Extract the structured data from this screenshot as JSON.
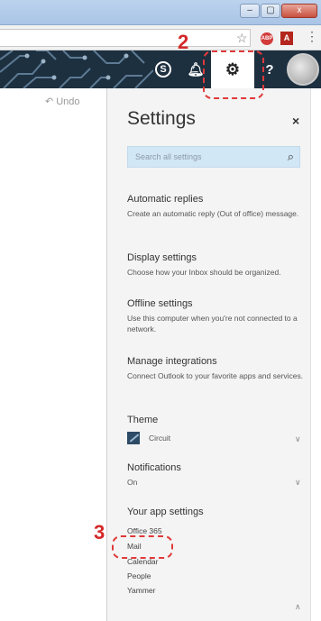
{
  "browser": {
    "window_buttons": [
      "–",
      "▢",
      "x"
    ],
    "extension_badge": "ABP",
    "pdf_icon": "A",
    "menu": "⋮"
  },
  "header": {
    "skype_label": "S",
    "help_label": "?"
  },
  "mail": {
    "undo_label": "Undo"
  },
  "settings": {
    "title": "Settings",
    "close": "×",
    "search_placeholder": "Search all settings",
    "items": [
      {
        "title": "Automatic replies",
        "desc": "Create an automatic reply (Out of office) message."
      },
      {
        "title": "Display settings",
        "desc": "Choose how your Inbox should be organized."
      },
      {
        "title": "Offline settings",
        "desc": "Use this computer when you're not connected to a network."
      },
      {
        "title": "Manage integrations",
        "desc": "Connect Outlook to your favorite apps and services."
      }
    ],
    "theme": {
      "title": "Theme",
      "value": "Circuit"
    },
    "notifications": {
      "title": "Notifications",
      "value": "On"
    },
    "app_settings": {
      "title": "Your app settings",
      "apps": [
        "Office 365",
        "Mail",
        "Calendar",
        "People",
        "Yammer"
      ]
    }
  },
  "annotations": {
    "step2": "2",
    "step3": "3",
    "color": "#d42828"
  },
  "colors": {
    "header_bg": "#1d3040",
    "search_bg": "#d2e7f6",
    "panel_bg": "#f4f4f4"
  }
}
